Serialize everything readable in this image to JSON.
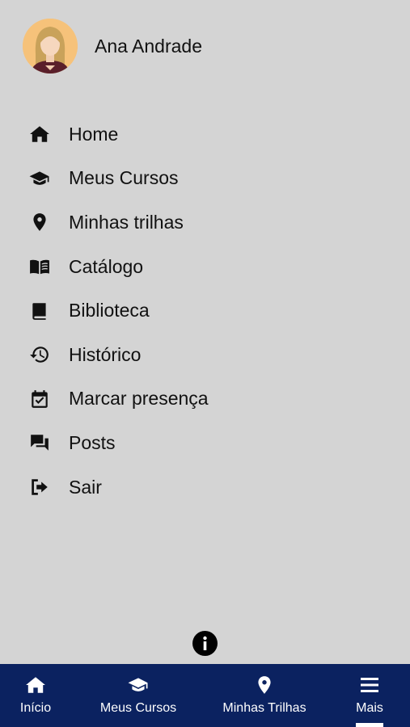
{
  "user": {
    "name": "Ana Andrade",
    "avatar_icon": "female-avatar-icon"
  },
  "menu": [
    {
      "label": "Home",
      "icon": "home-icon"
    },
    {
      "label": "Meus Cursos",
      "icon": "graduation-cap-icon"
    },
    {
      "label": "Minhas trilhas",
      "icon": "map-pin-icon"
    },
    {
      "label": "Catálogo",
      "icon": "open-book-icon"
    },
    {
      "label": "Biblioteca",
      "icon": "book-icon"
    },
    {
      "label": "Histórico",
      "icon": "history-icon"
    },
    {
      "label": "Marcar presença",
      "icon": "calendar-check-icon"
    },
    {
      "label": "Posts",
      "icon": "chat-bubbles-icon"
    },
    {
      "label": "Sair",
      "icon": "sign-out-icon"
    }
  ],
  "info": {
    "icon": "info-icon"
  },
  "bottom_nav": {
    "items": [
      {
        "label": "Início",
        "icon": "home-icon"
      },
      {
        "label": "Meus Cursos",
        "icon": "graduation-cap-icon"
      },
      {
        "label": "Minhas Trilhas",
        "icon": "map-pin-icon"
      },
      {
        "label": "Mais",
        "icon": "hamburger-menu-icon",
        "active": true
      }
    ]
  },
  "colors": {
    "background": "#d4d4d4",
    "nav_background": "#0b2260",
    "text": "#111111",
    "avatar_bg": "#f6c27a"
  }
}
